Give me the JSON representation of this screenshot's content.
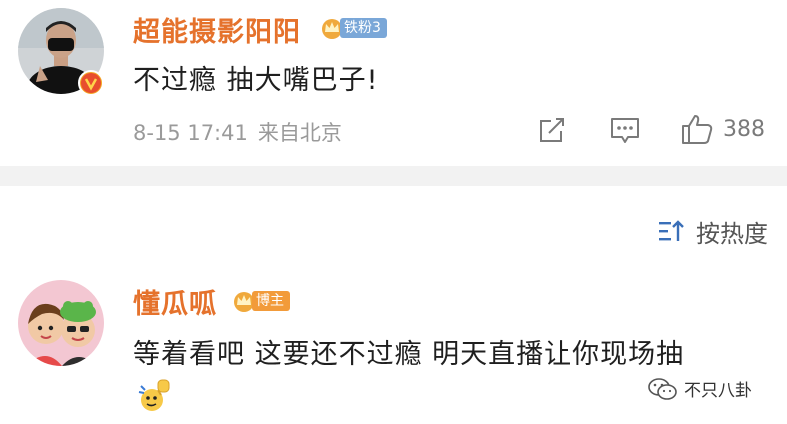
{
  "comments": [
    {
      "username": "超能摄影阳阳",
      "badge": "铁粉3",
      "text": "不过瘾 抽大嘴巴子!",
      "date": "8-15 17:41",
      "location": "来自北京",
      "like_count": "388"
    },
    {
      "username": "懂瓜呱",
      "badge": "博主",
      "text": "等着看吧  这要还不过瘾 明天直播让你现场抽",
      "emoji": "👊"
    }
  ],
  "sort": {
    "label": "按热度"
  },
  "watermark": {
    "text": "不只八卦"
  },
  "colors": {
    "username": "#e5722c",
    "meta": "#9a9a9a",
    "divider": "#f2f2f2",
    "badge_blue": "#7aa7d8",
    "badge_orange": "#f29b3a",
    "verified": "#f5a623"
  }
}
